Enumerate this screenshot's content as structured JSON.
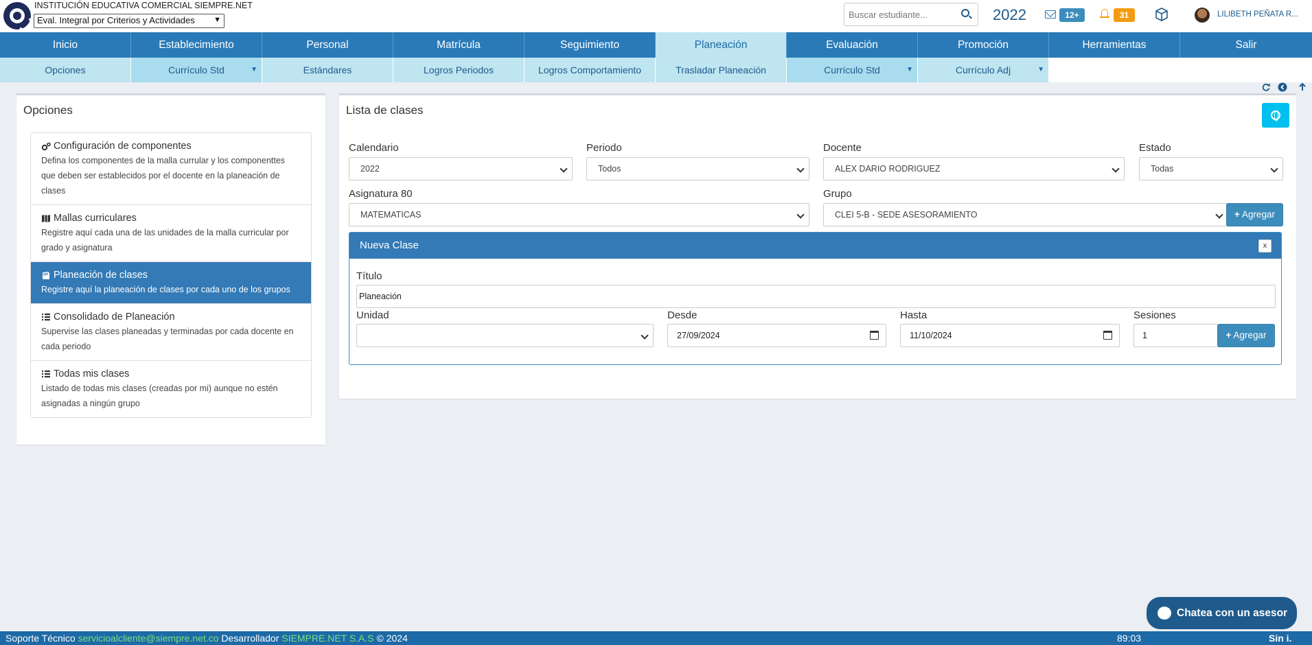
{
  "header": {
    "institution": "INSTITUCIÓN EDUCATIVA COMERCIAL SIEMPRE.NET",
    "eval_select": "Eval. Integral por Criterios y Actividades",
    "search_placeholder": "Buscar estudiante...",
    "year": "2022",
    "mail_count": "12+",
    "notif_count": "31",
    "user": "LILIBETH PEÑATA R..."
  },
  "main_menu": [
    "Inicio",
    "Establecimiento",
    "Personal",
    "Matrícula",
    "Seguimiento",
    "Planeación",
    "Evaluación",
    "Promoción",
    "Herramientas",
    "Salir"
  ],
  "sub_menu": [
    "Opciones",
    "Currículo Std",
    "Estándares",
    "Logros Periodos",
    "Logros Comportamiento",
    "Trasladar Planeación",
    "Currículo Std",
    "Currículo Adj"
  ],
  "left": {
    "title": "Opciones",
    "options": [
      {
        "title": "Configuración de componentes",
        "desc": "Defina los componentes de la malla currular y los componenttes que deben ser establecidos por el docente en la planeación de clases",
        "icon": "gears-icon"
      },
      {
        "title": "Mallas curriculares",
        "desc": "Registre aquí cada una de las unidades de la malla curricular por grado y asignatura",
        "icon": "map-icon"
      },
      {
        "title": "Planeación de clases",
        "desc": "Registre aquí la planeación de clases por cada uno de los grupos",
        "icon": "book-icon"
      },
      {
        "title": "Consolidado de Planeación",
        "desc": "Supervise las clases planeadas y terminadas por cada docente en cada periodo",
        "icon": "list-icon"
      },
      {
        "title": "Todas mis clases",
        "desc": "Listado de todas mis clases (creadas por mi) aunque no estén asignadas a ningún grupo",
        "icon": "list-icon"
      }
    ]
  },
  "main": {
    "title": "Lista de clases",
    "calendario_label": "Calendario",
    "calendario_value": "2022",
    "periodo_label": "Periodo",
    "periodo_value": "Todos",
    "docente_label": "Docente",
    "docente_value": "ALEX DARIO RODRIGUEZ",
    "estado_label": "Estado",
    "estado_value": "Todas",
    "asignatura_label": "Asignatura 80",
    "asignatura_value": "MATEMATICAS",
    "grupo_label": "Grupo",
    "grupo_value": "CLEI 5-B - SEDE ASESORAMIENTO",
    "agregar_label": "Agregar"
  },
  "nueva_clase": {
    "header": "Nueva Clase",
    "close": "x",
    "titulo_label": "Título",
    "titulo_value": "Planeación",
    "unidad_label": "Unidad",
    "unidad_value": "",
    "desde_label": "Desde",
    "desde_value": "27/09/2024",
    "hasta_label": "Hasta",
    "hasta_value": "11/10/2024",
    "sesiones_label": "Sesiones",
    "sesiones_value": "1",
    "agregar_label": "Agregar"
  },
  "chat": {
    "label": "Chatea con un asesor"
  },
  "footer": {
    "soporte": "Soporte Técnico",
    "email": "servicioalcliente@siempre.net.co",
    "desarrollador": "Desarrollador",
    "company": "SIEMPRE.NET S.A.S",
    "copyright": "© 2024",
    "time": "89:03",
    "brand": "Sin i."
  },
  "colors": {
    "primary": "#2a7ab8",
    "submenu": "#bfe5f1",
    "active_option": "#337ab7",
    "accent_cyan": "#00c0ef",
    "badge_orange": "#f39c12"
  }
}
